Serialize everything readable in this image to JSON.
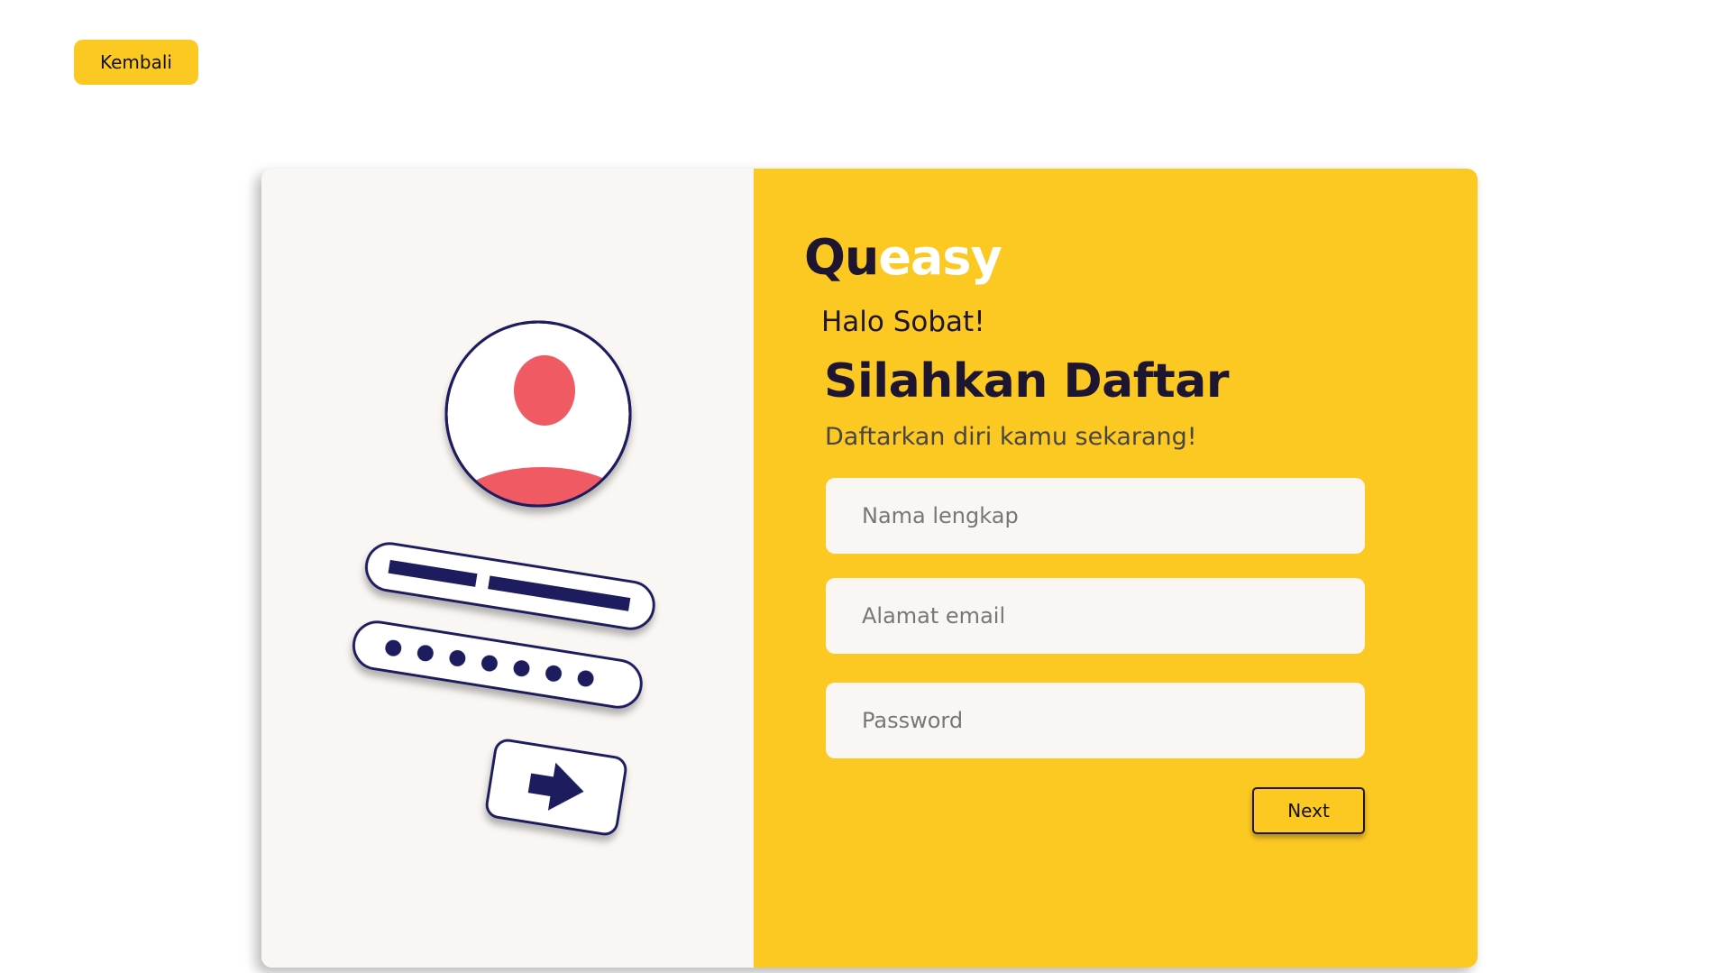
{
  "back_button": {
    "label": "Kembali"
  },
  "brand": {
    "part1": "Qu",
    "part2": "easy"
  },
  "form": {
    "greeting": "Halo Sobat!",
    "heading": "Silahkan Daftar",
    "subheading": "Daftarkan diri kamu sekarang!",
    "fields": [
      {
        "placeholder": "Nama lengkap",
        "value": ""
      },
      {
        "placeholder": "Alamat email",
        "value": ""
      },
      {
        "placeholder": "Password",
        "value": ""
      }
    ],
    "next_label": "Next"
  },
  "colors": {
    "accent_yellow": "#fcc822",
    "panel_light": "#f9f6f3",
    "dark_navy": "#1e1530",
    "avatar_coral": "#f05a63",
    "white": "#ffffff"
  },
  "icons": [
    "user-avatar-icon",
    "username-field-icon",
    "password-dots-icon",
    "arrow-right-icon"
  ]
}
